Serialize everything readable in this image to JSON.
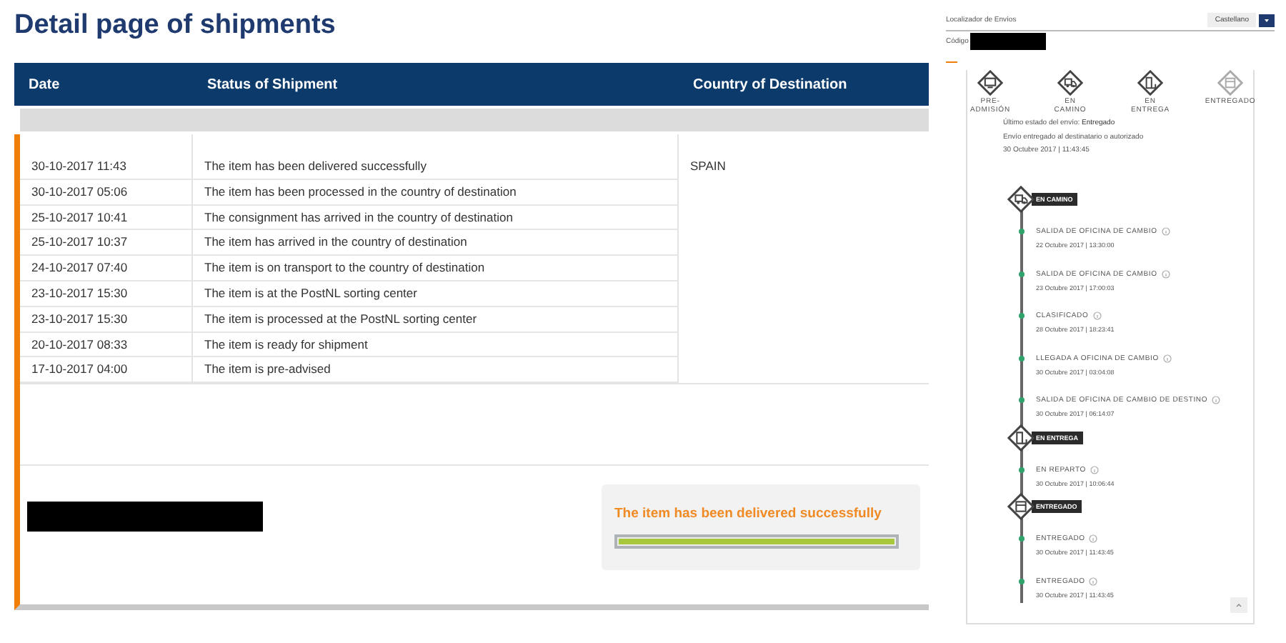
{
  "page_title": "Detail page of shipments",
  "table": {
    "columns": [
      "Date",
      "Status of Shipment",
      "Country of Destination"
    ],
    "country": "SPAIN",
    "rows": [
      {
        "date": "30-10-2017 11:43",
        "status": "The item has been delivered successfully"
      },
      {
        "date": "30-10-2017 05:06",
        "status": "The item has been processed in the country of destination"
      },
      {
        "date": "25-10-2017 10:41",
        "status": "The consignment has arrived in the country of destination"
      },
      {
        "date": "25-10-2017 10:37",
        "status": "The item has arrived in the country of destination"
      },
      {
        "date": "24-10-2017 07:40",
        "status": "The item is on transport to the country of destination"
      },
      {
        "date": "23-10-2017 15:30",
        "status": "The item is at the PostNL sorting center"
      },
      {
        "date": "23-10-2017 15:30",
        "status": "The item is processed at the PostNL sorting center"
      },
      {
        "date": "20-10-2017 08:33",
        "status": "The item is ready for shipment"
      },
      {
        "date": "17-10-2017 04:00",
        "status": "The item is pre-advised"
      }
    ]
  },
  "status_box": {
    "message": "The item has been delivered successfully",
    "level": 1
  },
  "tracker": {
    "title": "Localizador de Envíos",
    "language": "Castellano",
    "code_label": "Código",
    "stages": [
      {
        "label": "PRE-ADMISIÓN",
        "kind": "monitor",
        "current": false
      },
      {
        "label": "EN CAMINO",
        "kind": "truck",
        "current": false
      },
      {
        "label": "EN ENTREGA",
        "kind": "door",
        "current": false
      },
      {
        "label": "ENTREGADO",
        "kind": "box",
        "current": true
      }
    ],
    "last_status_label": "Último estado del envío:",
    "last_status": "Entregado",
    "last_detail": "Envío entregado al destinatario o autorizado",
    "last_time": "30 Octubre 2017 | 11:43:45",
    "sections": [
      {
        "title": "EN CAMINO",
        "kind": "truck",
        "events": [
          {
            "title": "SALIDA DE OFICINA DE CAMBIO",
            "time": "22 Octubre 2017 | 13:30:00"
          },
          {
            "title": "SALIDA DE OFICINA DE CAMBIO",
            "time": "23 Octubre 2017 | 17:00:03"
          },
          {
            "title": "CLASIFICADO",
            "time": "28 Octubre 2017 | 18:23:41"
          },
          {
            "title": "LLEGADA A OFICINA DE CAMBIO",
            "time": "30 Octubre 2017 | 03:04:08"
          },
          {
            "title": "SALIDA DE OFICINA DE CAMBIO DE DESTINO",
            "time": "30 Octubre 2017 | 06:14:07"
          }
        ]
      },
      {
        "title": "EN ENTREGA",
        "kind": "door",
        "events": [
          {
            "title": "EN REPARTO",
            "time": "30 Octubre 2017 | 10:06:44"
          }
        ]
      },
      {
        "title": "ENTREGADO",
        "kind": "box",
        "events": [
          {
            "title": "ENTREGADO",
            "time": "30 Octubre 2017 | 11:43:45"
          },
          {
            "title": "ENTREGADO",
            "time": "30 Octubre 2017 | 11:43:45"
          }
        ]
      }
    ]
  }
}
